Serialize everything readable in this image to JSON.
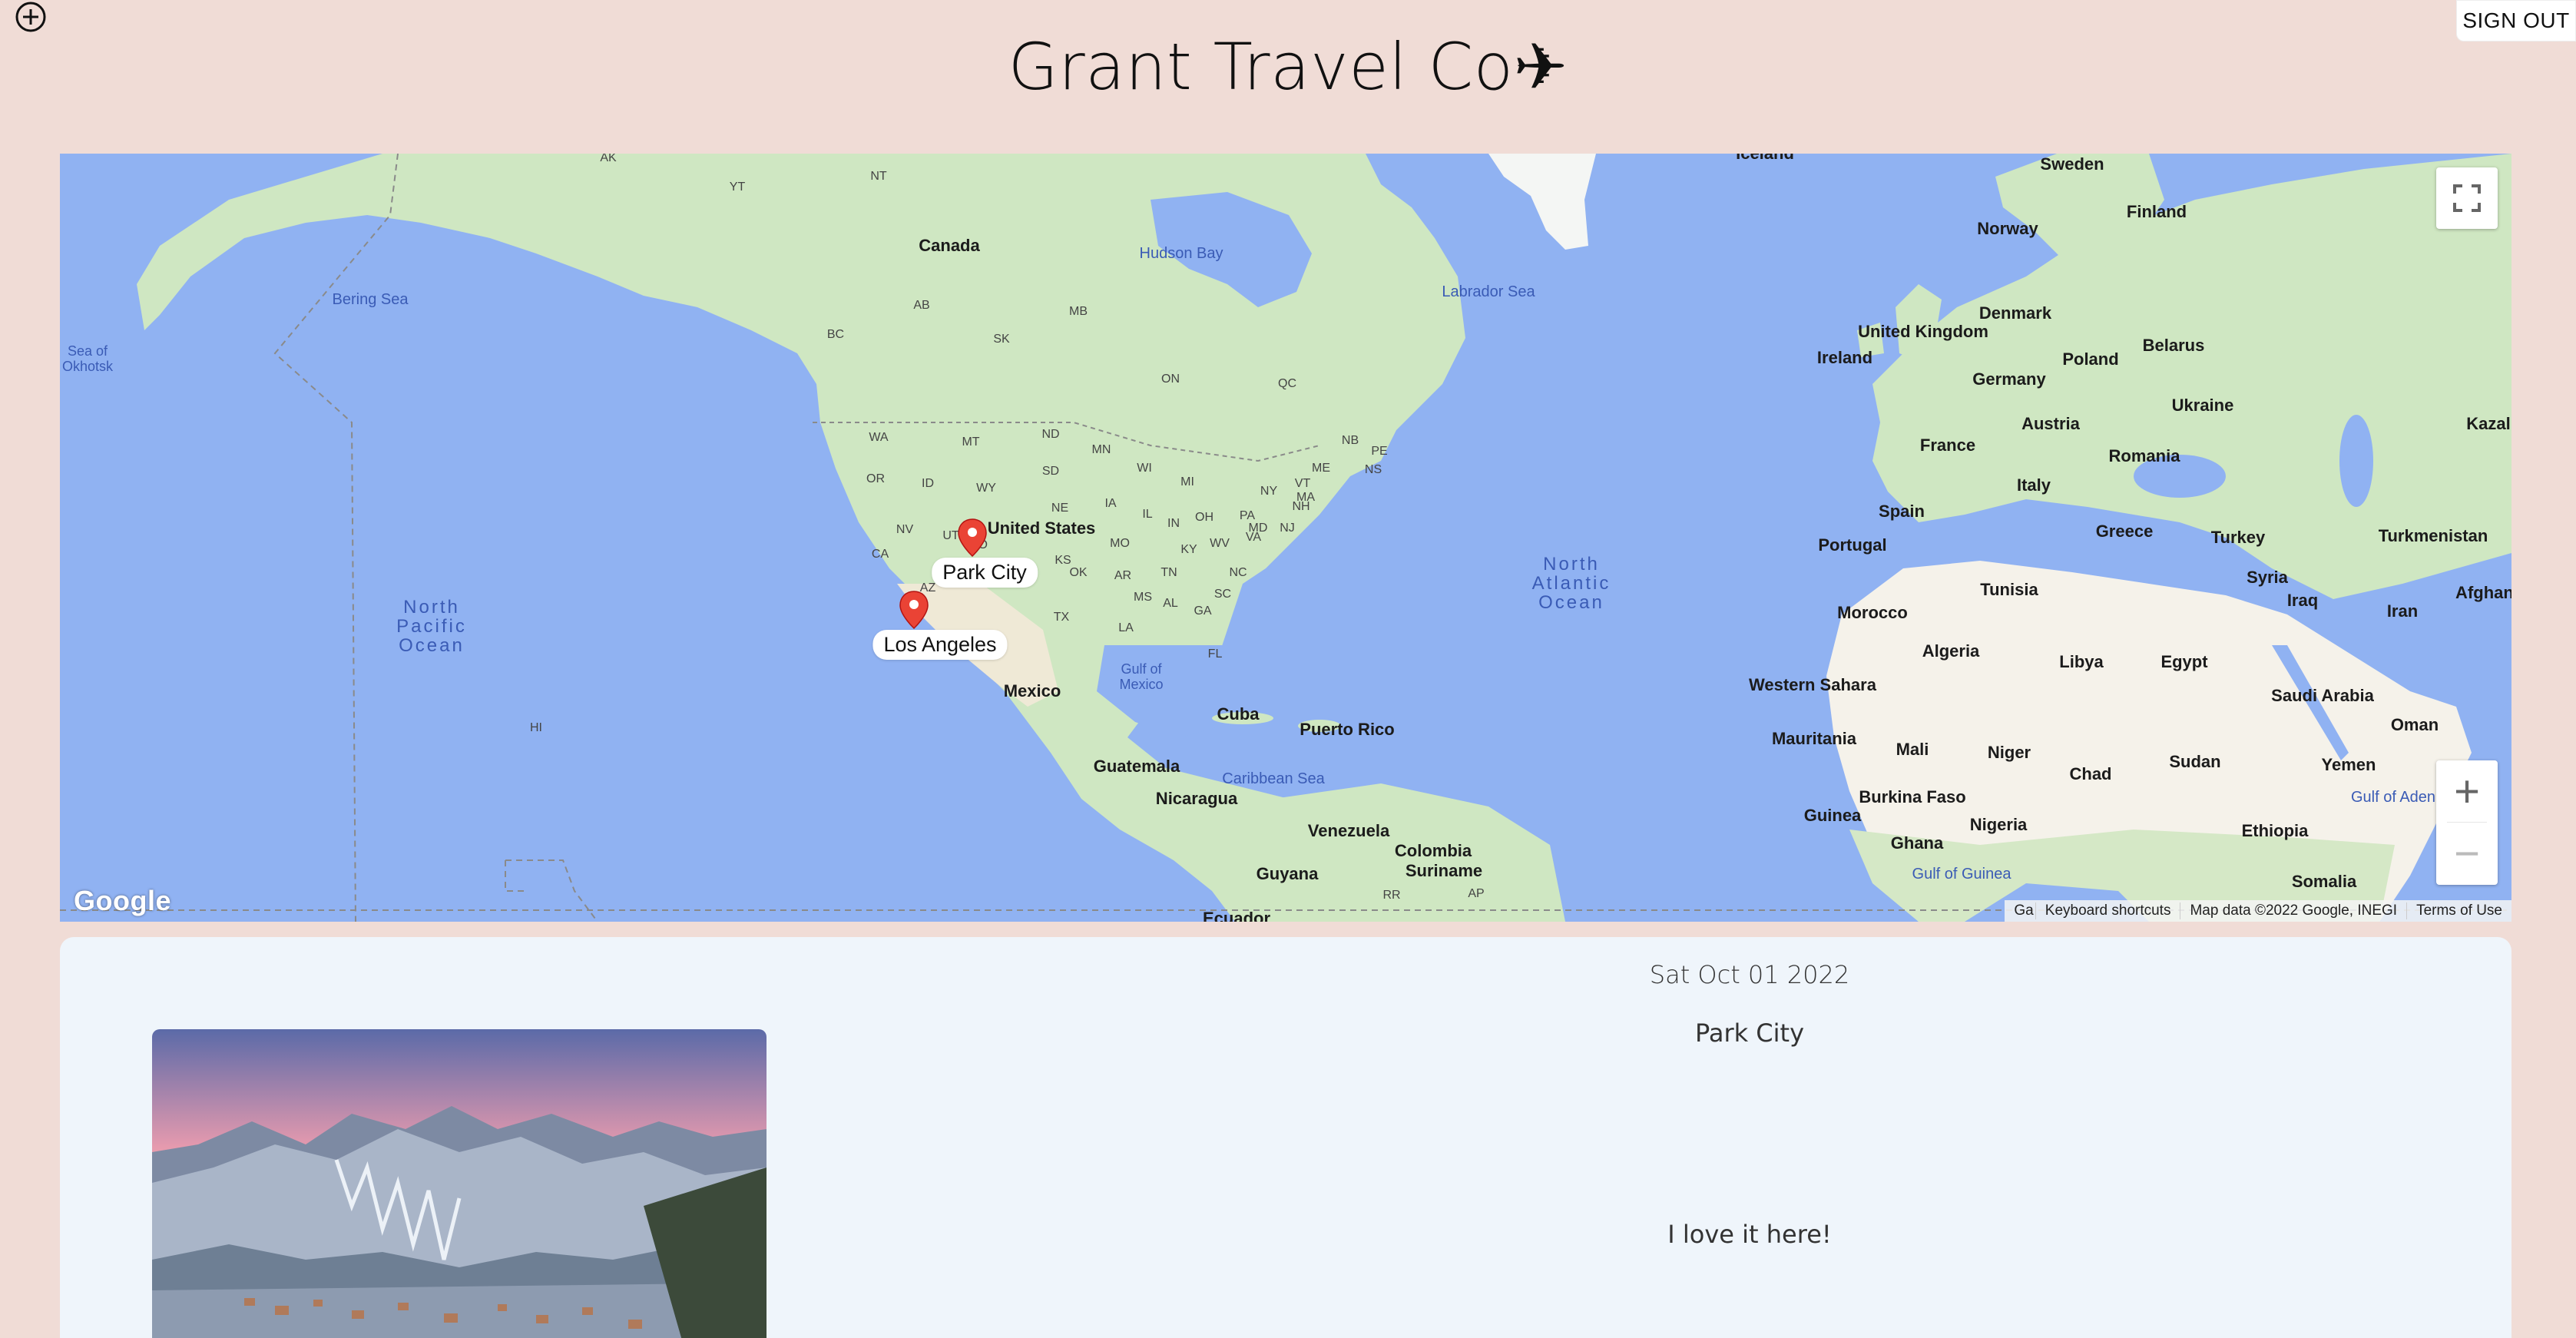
{
  "header": {
    "title": "Grant Travel Co✈",
    "add_icon": "plus-circle-icon",
    "sign_out_label": "SIGN OUT"
  },
  "map": {
    "countries": [
      "Canada",
      "United States",
      "Mexico",
      "Cuba",
      "Puerto Rico",
      "Guatemala",
      "Nicaragua",
      "Venezuela",
      "Colombia",
      "Guyana",
      "Suriname",
      "Ecuador",
      "Sweden",
      "Norway",
      "Finland",
      "United Kingdom",
      "Denmark",
      "Ireland",
      "Poland",
      "Belarus",
      "Germany",
      "Ukraine",
      "Austria",
      "France",
      "Romania",
      "Italy",
      "Spain",
      "Portugal",
      "Greece",
      "Turkey",
      "Turkmenistan",
      "Tunisia",
      "Syria",
      "Iraq",
      "Iran",
      "Afghani",
      "Morocco",
      "Algeria",
      "Libya",
      "Egypt",
      "Western Sahara",
      "Saudi Arabia",
      "Oman",
      "Mauritania",
      "Mali",
      "Niger",
      "Chad",
      "Sudan",
      "Yemen",
      "Burkina Faso",
      "Guinea",
      "Nigeria",
      "Ghana",
      "Ethiopia",
      "Somalia",
      "Iceland",
      "Kazal"
    ],
    "regions": [
      "AK",
      "YT",
      "NT",
      "BC",
      "AB",
      "SK",
      "MB",
      "ON",
      "QC",
      "NB",
      "PE",
      "NS",
      "WA",
      "MT",
      "ND",
      "MN",
      "OR",
      "ID",
      "WY",
      "SD",
      "WI",
      "MI",
      "NV",
      "UT",
      "NE",
      "IA",
      "IL",
      "IN",
      "OH",
      "PA",
      "NY",
      "VT",
      "NH",
      "MA",
      "ME",
      "CA",
      "AZ",
      "CO",
      "KS",
      "MO",
      "KY",
      "WV",
      "VA",
      "MD",
      "NJ",
      "OK",
      "AR",
      "TN",
      "NC",
      "TX",
      "LA",
      "MS",
      "AL",
      "GA",
      "SC",
      "FL",
      "HI",
      "RR",
      "AP"
    ],
    "water_bodies": [
      "Hudson Bay",
      "Labrador Sea",
      "Bering Sea",
      "Sea of Okhotsk",
      "Gulf of Mexico",
      "Caribbean Sea",
      "Gulf of Guinea",
      "Gulf of Aden"
    ],
    "oceans": [
      "North Pacific Ocean",
      "North Atlantic Ocean"
    ],
    "markers": [
      {
        "name": "Park City"
      },
      {
        "name": "Los Angeles"
      }
    ],
    "fullscreen_icon": "fullscreen-icon",
    "zoom_in_label": "+",
    "zoom_out_label": "−",
    "logo_text": "Google",
    "keyboard_shortcuts": "Keyboard shortcuts",
    "map_data": "Map data ©2022 Google, INEGI",
    "terms": "Terms of Use",
    "ga_fragment": "Ga"
  },
  "entry": {
    "date": "Sat Oct 01 2022",
    "place": "Park City",
    "note": "I love it here!",
    "photo_icon": "mountain-town-photo"
  },
  "colors": {
    "page_bg": "#f0dcd6",
    "card_bg": "#eff5fb",
    "water": "#90b2f2",
    "land_green": "#cfe7c2",
    "land_desert": "#f5f2ea",
    "marker_red": "#ea4335"
  }
}
